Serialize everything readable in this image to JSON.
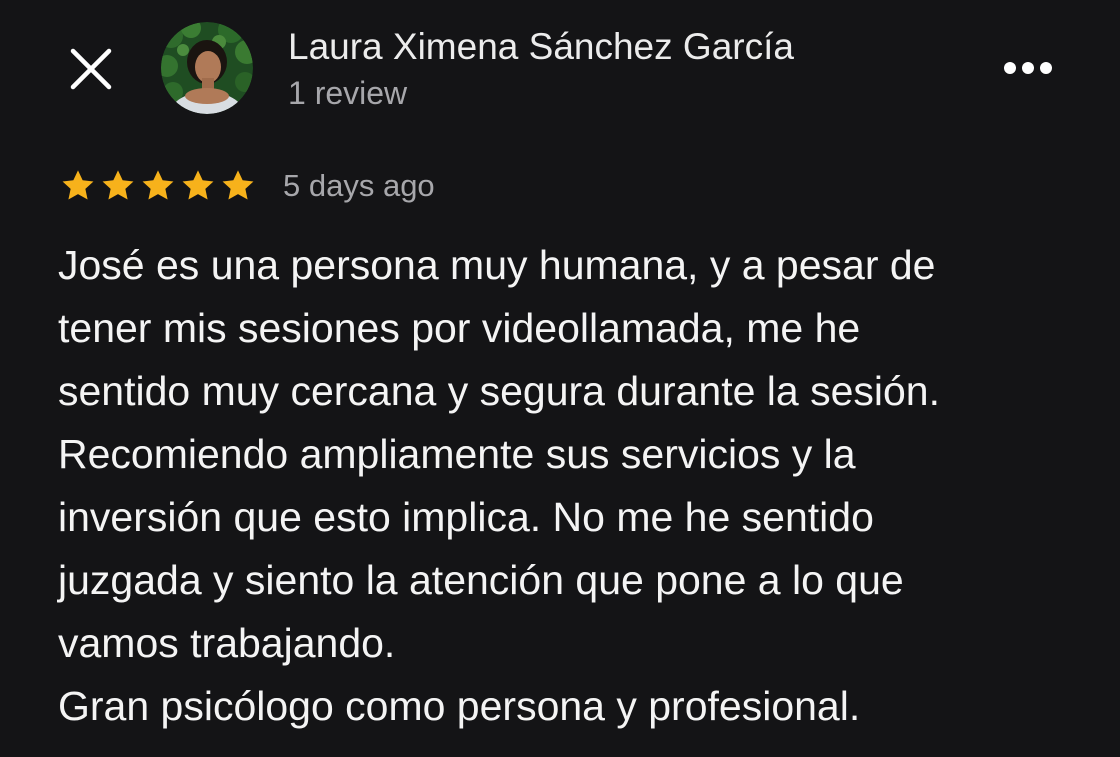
{
  "header": {
    "close_icon": "close-icon",
    "author_name": "Laura Ximena Sánchez García",
    "review_count": "1 review",
    "more_icon": "more-horizontal-icon"
  },
  "review": {
    "rating": 5,
    "max_rating": 5,
    "star_color": "#f7b21b",
    "date": "5 days ago",
    "lines": [
      "José es una persona muy humana, y a pesar de",
      "tener mis sesiones por videollamada, me he",
      "sentido muy cercana y segura durante la sesión.",
      "Recomiendo ampliamente sus servicios y la",
      "inversión que esto implica. No me he sentido",
      "juzgada y siento la atención que pone a lo que",
      "vamos trabajando.",
      "Gran psicólogo como persona y profesional."
    ]
  },
  "colors": {
    "background": "#141416",
    "primary_text": "#f4f4f4",
    "secondary_text": "#a7a7ab"
  }
}
